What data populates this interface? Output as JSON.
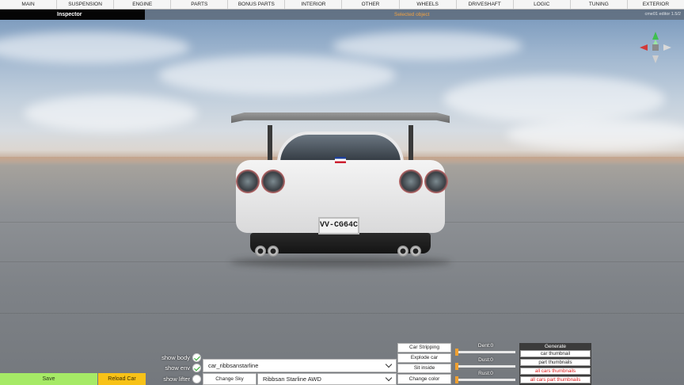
{
  "menu": {
    "items": [
      "MAIN",
      "SUSPENSION",
      "ENGINE",
      "PARTS",
      "BONUS PARTS",
      "INTERIOR",
      "OTHER",
      "WHEELS",
      "DRIVESHAFT",
      "LOGIC",
      "TUNING",
      "EXTERIOR"
    ]
  },
  "subheader": {
    "inspector_label": "Inspector",
    "selected_object_label": "Selected object",
    "version_text": "cme01 editor 1.5/2"
  },
  "scene": {
    "license_plate": "VV-CG64C"
  },
  "bottom": {
    "save_label": "Save",
    "reload_label": "Reload Car",
    "toggles": [
      {
        "label": "show body",
        "checked": true
      },
      {
        "label": "show env",
        "checked": true
      },
      {
        "label": "show lifter",
        "checked": false
      }
    ],
    "car_select_value": "car_ribbsanstarline",
    "change_sky_label": "Change Sky",
    "model_select_value": "Ribbsan Starline AWD",
    "actions": [
      "Car Stripping",
      "Explode car",
      "Sit inside",
      "Change color"
    ],
    "sliders": [
      {
        "label": "Dent:0",
        "value": 0
      },
      {
        "label": "Dust:0",
        "value": 0
      },
      {
        "label": "Rust:0",
        "value": 0
      }
    ],
    "generate": {
      "title": "Generate",
      "buttons": [
        {
          "label": "car thumbnail",
          "color": "#222222"
        },
        {
          "label": "part thumbnails",
          "color": "#222222"
        },
        {
          "label": "all cars thumbnails",
          "color": "#e02020"
        },
        {
          "label": "all cars part thumbnails",
          "color": "#e02020"
        }
      ]
    }
  },
  "colors": {
    "save_bg": "#a6ea66",
    "reload_bg": "#f8c217",
    "accent_orange": "#f0a040",
    "check_green": "#28a828"
  }
}
